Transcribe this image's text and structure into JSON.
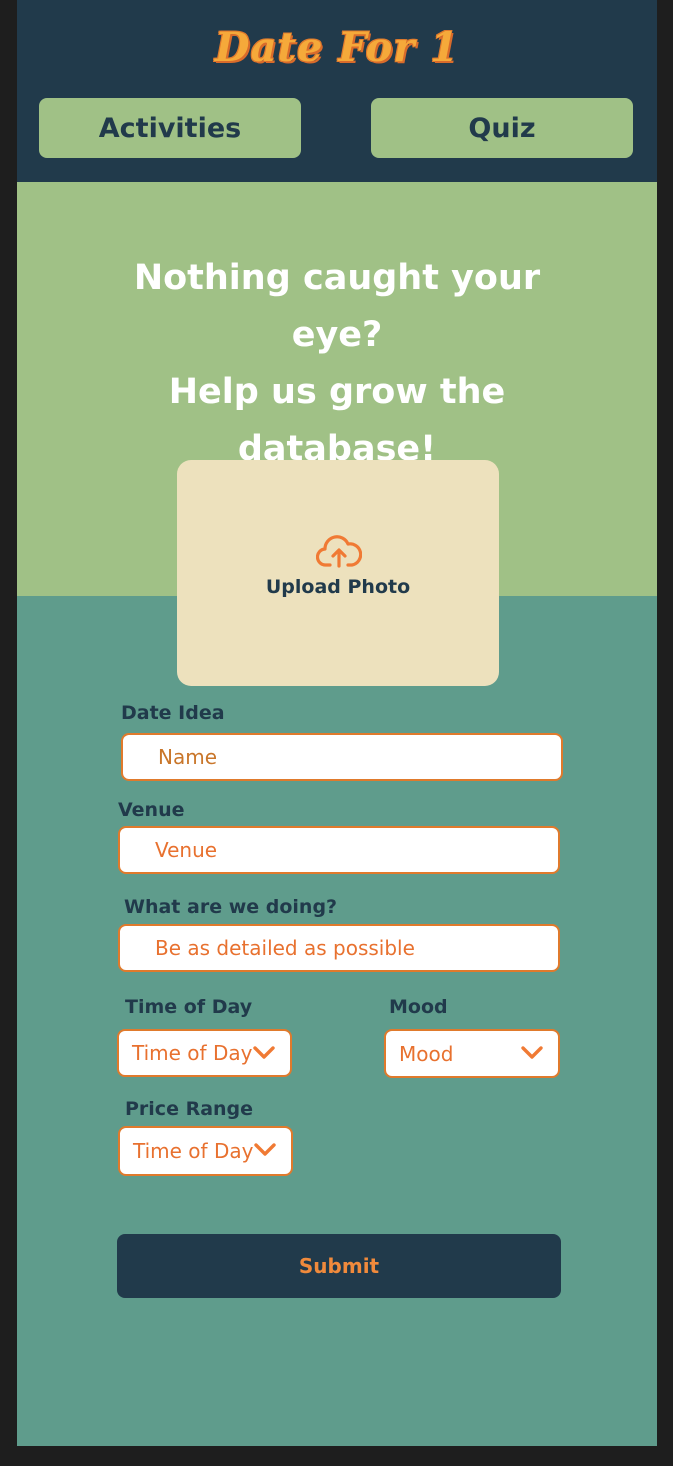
{
  "header": {
    "logo": "Date For 1",
    "nav": [
      {
        "label": "Activities"
      },
      {
        "label": "Quiz"
      }
    ]
  },
  "hero": {
    "title_lines": [
      "Nothing caught your eye?",
      "Help us grow the",
      "database!"
    ]
  },
  "upload": {
    "icon": "cloud-upload-icon",
    "label": "Upload Photo"
  },
  "form": {
    "date_idea": {
      "label": "Date Idea",
      "placeholder": "Name"
    },
    "venue": {
      "label": "Venue",
      "placeholder": "Venue"
    },
    "details": {
      "label": "What are we doing?",
      "placeholder": "Be as detailed as possible"
    },
    "time_of_day": {
      "label": "Time of Day",
      "value": "Time of Day"
    },
    "mood": {
      "label": "Mood",
      "value": "Mood"
    },
    "price_range": {
      "label": "Price Range",
      "value": "Time of Day"
    },
    "submit_label": "Submit"
  },
  "colors": {
    "navy": "#213a4b",
    "sage": "#a0c186",
    "teal": "#5f9c8c",
    "cream": "#ede1bd",
    "orange": "#e07a2c",
    "logo_gold": "#f5a93a"
  }
}
